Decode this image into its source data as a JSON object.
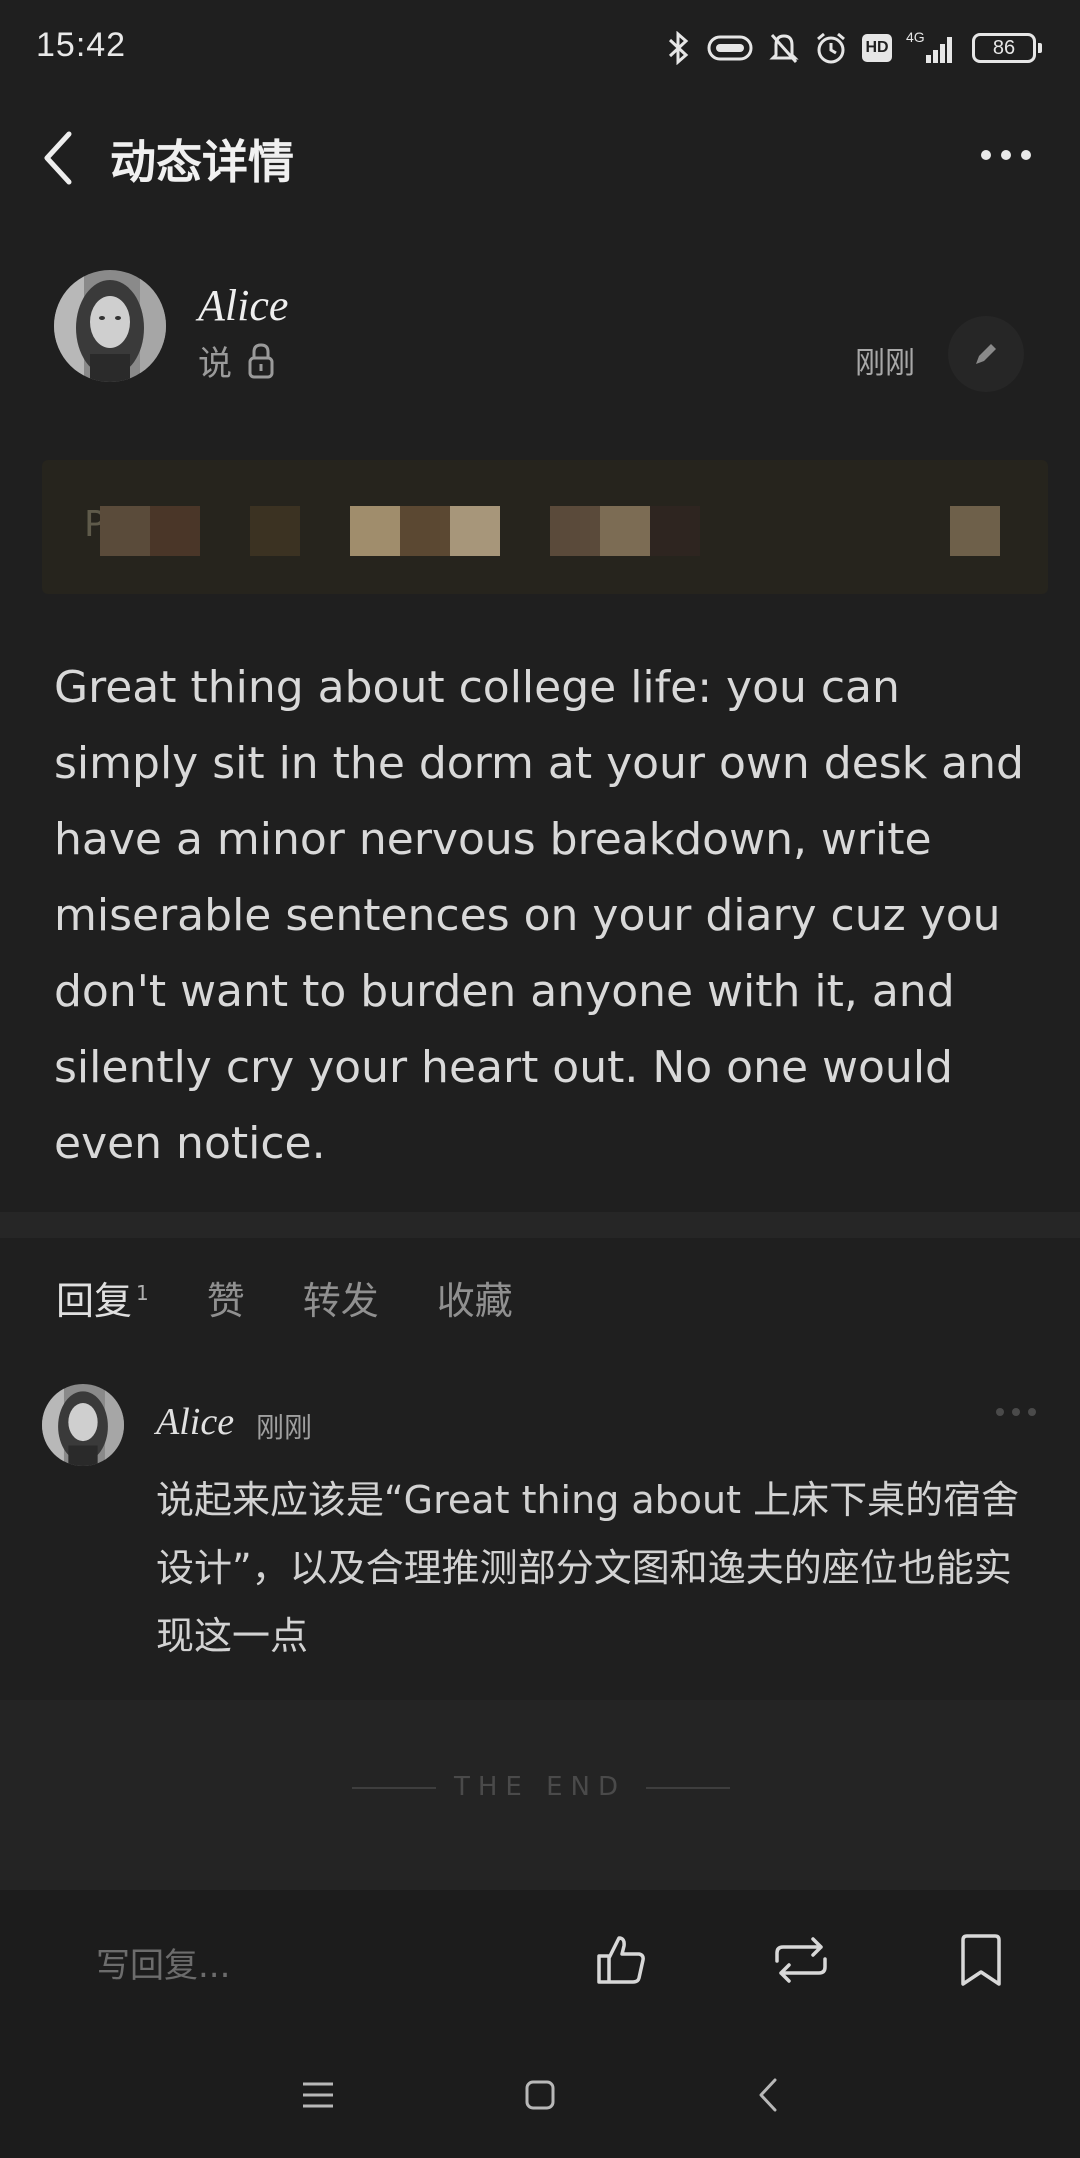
{
  "status_bar": {
    "time": "15:42",
    "battery": "86",
    "network": "4G",
    "hd": "HD",
    "icons": [
      "bluetooth-icon",
      "vibrate-icon",
      "mute-bell-icon",
      "alarm-icon",
      "hd-icon",
      "signal-icon",
      "battery-icon"
    ]
  },
  "header": {
    "title": "动态详情"
  },
  "post": {
    "author": "Alice",
    "subtitle": "说",
    "time": "刚刚",
    "banner_first_char": "P",
    "text": "Great thing about college life: you can simply sit in the dorm at your own desk and have a minor nervous breakdown, write miserable sentences on your diary cuz you don't want to burden anyone with it, and silently cry your heart out. No one would even notice."
  },
  "tabs": [
    {
      "label": "回复",
      "count": "1"
    },
    {
      "label": "赞"
    },
    {
      "label": "转发"
    },
    {
      "label": "收藏"
    }
  ],
  "comment": {
    "author": "Alice",
    "time": "刚刚",
    "text": "说起来应该是“Great thing about 上床下桌的宿舍设计”，以及合理推测部分文图和逸夫的座位也能实现这一点"
  },
  "end_label": "THE END",
  "bottom_bar": {
    "reply_placeholder": "写回复..."
  },
  "colors": {
    "background": "#1f1f1f",
    "text": "#d9d9d9",
    "muted": "#909090",
    "banner": "#26241d"
  }
}
